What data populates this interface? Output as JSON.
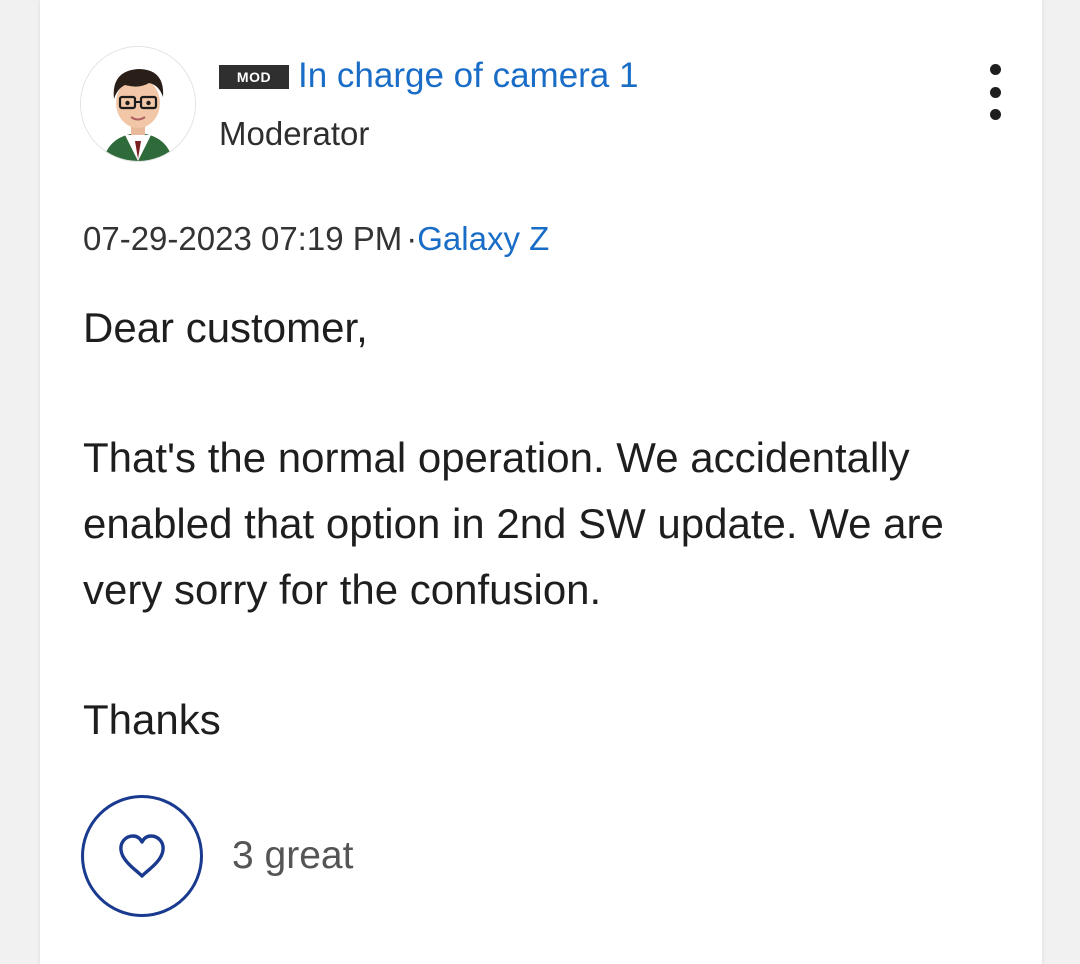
{
  "author": {
    "badge": "MOD",
    "name": "In charge of camera 1",
    "role": "Moderator"
  },
  "post": {
    "datetime": "07-29-2023 07:19 PM",
    "separator": "·",
    "board": "Galaxy Z",
    "greeting": "Dear customer,",
    "message": "That's the normal operation. We accidentally enabled that option in 2nd SW update. We are very sorry for the confusion.",
    "signoff": "Thanks"
  },
  "reactions": {
    "count_label": "3 great"
  },
  "icons": {
    "menu": "more-vertical-icon",
    "like": "heart-icon"
  },
  "colors": {
    "link": "#1a6dc6",
    "like_border": "#1a3a8f",
    "badge_bg": "#2f2f2f"
  }
}
